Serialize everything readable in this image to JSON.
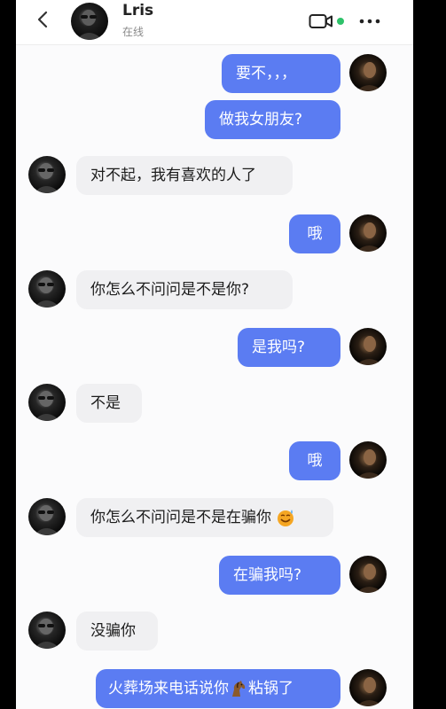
{
  "header": {
    "contact_name": "Lris",
    "status": "在线",
    "icons": [
      "back-chevron-icon",
      "video-call-icon",
      "more-options-icon"
    ],
    "online_color": "#2ec26a"
  },
  "colors": {
    "sent_bubble": "#5b7cf2",
    "received_bubble": "#f0f0f2"
  },
  "messages": [
    {
      "from": "me",
      "text": "要不，，，"
    },
    {
      "from": "me",
      "text": "做我女朋友?"
    },
    {
      "from": "her",
      "text": "对不起，我有喜欢的人了"
    },
    {
      "from": "me",
      "text": "哦"
    },
    {
      "from": "her",
      "text": "你怎么不问问是不是你?"
    },
    {
      "from": "me",
      "text": "是我吗?"
    },
    {
      "from": "her",
      "text": "不是"
    },
    {
      "from": "me",
      "text": "哦"
    },
    {
      "from": "her",
      "text": "你怎么不问问是不是在骗你",
      "emoji": "sweat-smile-emoji-icon"
    },
    {
      "from": "me",
      "text": "在骗我吗?"
    },
    {
      "from": "her",
      "text": "没骗你"
    },
    {
      "from": "me",
      "text_before": "火葬场来电话说你",
      "emoji": "horse-emoji-icon",
      "text_after": "粘锅了"
    }
  ]
}
